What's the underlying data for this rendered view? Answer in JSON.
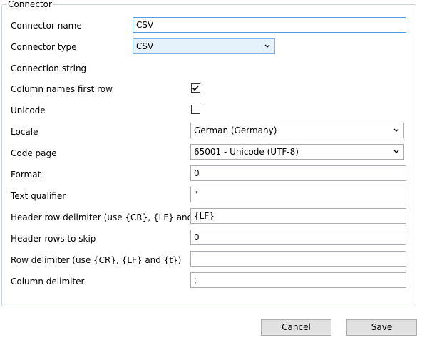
{
  "group": {
    "title": "Connector"
  },
  "fields": {
    "connector_name": {
      "label": "Connector name",
      "value": "CSV"
    },
    "connector_type": {
      "label": "Connector type",
      "value": "CSV"
    },
    "connection_string": {
      "label": "Connection string"
    },
    "column_names_first_row": {
      "label": "Column names first row",
      "checked": true
    },
    "unicode": {
      "label": "Unicode",
      "checked": false
    },
    "locale": {
      "label": "Locale",
      "value": "German (Germany)"
    },
    "code_page": {
      "label": "Code page",
      "value": "65001 - Unicode (UTF-8)"
    },
    "format": {
      "label": "Format",
      "value": "0"
    },
    "text_qualifier": {
      "label": "Text qualifier",
      "value": "\""
    },
    "header_row_delimiter": {
      "label": "Header row delimiter (use {CR}, {LF} and {t})",
      "value": "{LF}"
    },
    "header_rows_to_skip": {
      "label": "Header rows to skip",
      "value": "0"
    },
    "row_delimiter": {
      "label": "Row delimiter (use {CR}, {LF} and {t})",
      "value": ""
    },
    "column_delimiter": {
      "label": "Column delimiter",
      "value": ";"
    }
  },
  "buttons": {
    "cancel": "Cancel",
    "save": "Save"
  },
  "icons": {
    "dropdown": "chevron-down-icon",
    "check": "checkmark-icon"
  },
  "colors": {
    "focus_border": "#569de5",
    "hover_combo": "#e5f1fb",
    "group_border": "#c8d3df"
  }
}
